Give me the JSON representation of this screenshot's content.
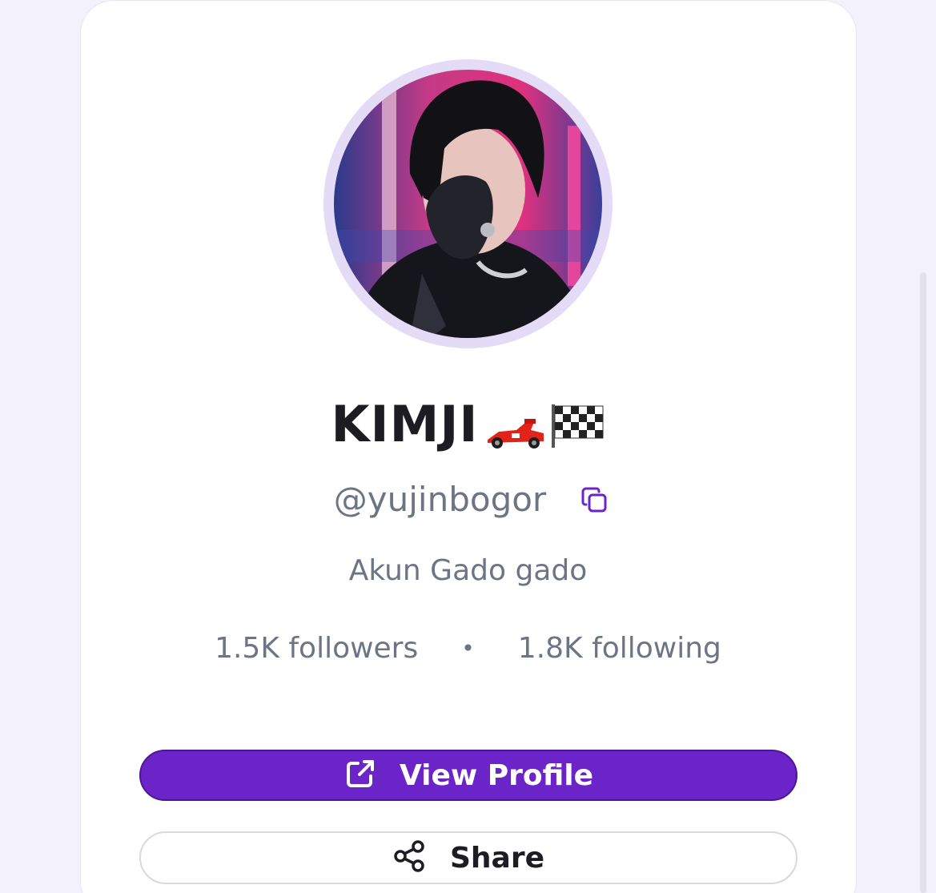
{
  "profile": {
    "display_name": "KIMJI",
    "name_emojis": [
      "racing-car-icon",
      "checkered-flag-icon"
    ],
    "handle": "@yujinbogor",
    "bio": "Akun Gado gado",
    "followers": "1.5K followers",
    "separator": "•",
    "following": "1.8K following"
  },
  "actions": {
    "view_profile_label": "View Profile",
    "view_profile_icon": "external-link-icon",
    "share_label": "Share",
    "share_icon": "share-icon",
    "copy_icon": "copy-icon"
  },
  "colors": {
    "accent": "#6b24c8",
    "muted_text": "#6c7486",
    "avatar_ring": "#e4dcf6"
  }
}
